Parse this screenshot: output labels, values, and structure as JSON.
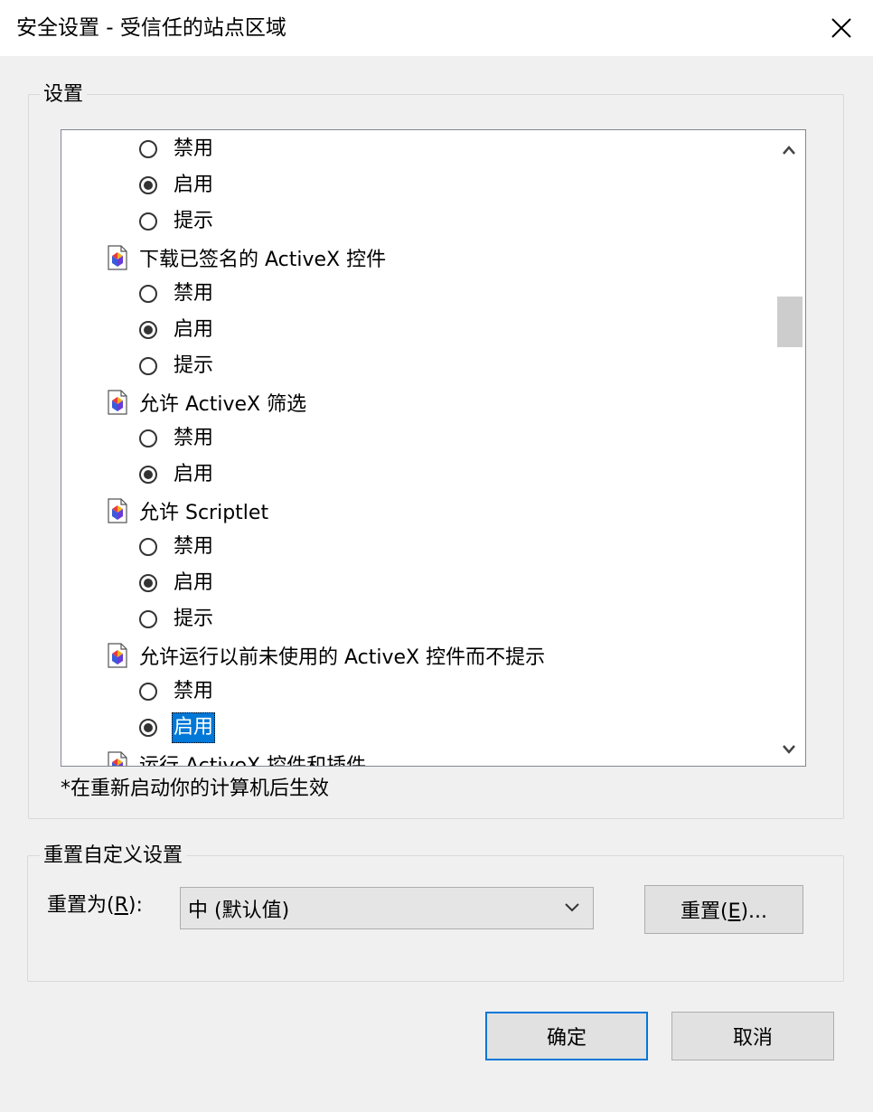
{
  "window": {
    "title": "安全设置 - 受信任的站点区域",
    "close_icon": "close-icon"
  },
  "settings_group": {
    "label": "设置",
    "items": [
      {
        "type": "option",
        "label": "禁用",
        "checked": false
      },
      {
        "type": "option",
        "label": "启用",
        "checked": true
      },
      {
        "type": "option",
        "label": "提示",
        "checked": false
      },
      {
        "type": "heading",
        "label": "下载已签名的 ActiveX 控件",
        "icon": "settings-doc-icon"
      },
      {
        "type": "option",
        "label": "禁用",
        "checked": false
      },
      {
        "type": "option",
        "label": "启用",
        "checked": true
      },
      {
        "type": "option",
        "label": "提示",
        "checked": false
      },
      {
        "type": "heading",
        "label": "允许 ActiveX 筛选",
        "icon": "settings-doc-icon"
      },
      {
        "type": "option",
        "label": "禁用",
        "checked": false
      },
      {
        "type": "option",
        "label": "启用",
        "checked": true
      },
      {
        "type": "heading",
        "label": "允许 Scriptlet",
        "icon": "settings-doc-icon"
      },
      {
        "type": "option",
        "label": "禁用",
        "checked": false
      },
      {
        "type": "option",
        "label": "启用",
        "checked": true
      },
      {
        "type": "option",
        "label": "提示",
        "checked": false
      },
      {
        "type": "heading",
        "label": "允许运行以前未使用的 ActiveX 控件而不提示",
        "icon": "settings-doc-icon"
      },
      {
        "type": "option",
        "label": "禁用",
        "checked": false
      },
      {
        "type": "option",
        "label": "启用",
        "checked": true,
        "selected": true
      },
      {
        "type": "heading",
        "label": "运行 ActiveX 控件和插件",
        "icon": "settings-doc-icon"
      }
    ],
    "note": "*在重新启动你的计算机后生效"
  },
  "reset_group": {
    "label": "重置自定义设置",
    "reset_to_label": "重置为",
    "reset_to_key": "R",
    "reset_to_suffix": "):",
    "dropdown_value": "中 (默认值)",
    "reset_button_label": "重置",
    "reset_button_key": "E",
    "reset_button_suffix": ")..."
  },
  "buttons": {
    "ok": "确定",
    "cancel": "取消"
  },
  "colors": {
    "accent": "#0078d7",
    "window_bg": "#f0f0f0"
  }
}
